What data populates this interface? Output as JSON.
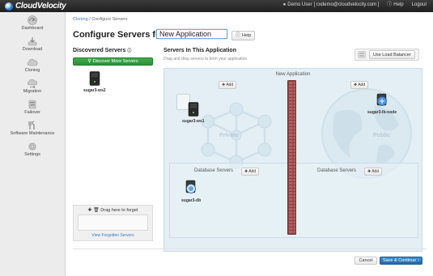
{
  "app": {
    "name": "CloudVelocity"
  },
  "topbar": {
    "user_label": "Demo User",
    "user_email": "[ cxdemo@cloudvelocity.com ]",
    "help_label": "Help",
    "logout_label": "Logout"
  },
  "sidebar": {
    "items": [
      {
        "label": "Dashboard",
        "icon": "dashboard-icon"
      },
      {
        "label": "Download",
        "icon": "download-icon"
      },
      {
        "label": "Cloning",
        "icon": "cloud-icon"
      },
      {
        "label": "Migration",
        "icon": "migration-icon"
      },
      {
        "label": "Failover",
        "icon": "failover-icon"
      },
      {
        "label": "Software Maintenance",
        "icon": "wrench-icon"
      },
      {
        "label": "Settings",
        "icon": "gear-icon"
      }
    ]
  },
  "breadcrumb": {
    "parent": "Cloning",
    "separator": "/",
    "current": "Configure Servers"
  },
  "page": {
    "title": "Configure Servers for",
    "app_name_value": "New Application",
    "help_label": "Help"
  },
  "discovered": {
    "title": "Discovered Servers",
    "discover_button": "Discover More Servers",
    "servers": [
      {
        "name": "sugar3-ws2"
      }
    ],
    "forget_label": "Drag here to forget",
    "forgotten_link": "View Forgotten Servers"
  },
  "application": {
    "title": "Servers In This Application",
    "subtitle": "Drag and drop servers to form your application",
    "load_balancer_button": "Use Load Balancer",
    "canvas_title": "New Application",
    "private_label": "Private",
    "public_label": "Public",
    "add_label": "Add",
    "private_servers": [
      {
        "name": "sugar3-ws1"
      }
    ],
    "public_servers": [
      {
        "name": "sugar3-lb-node"
      }
    ],
    "database_section_label": "Database Servers",
    "private_db_servers": [
      {
        "name": "sugar3-db"
      }
    ]
  },
  "footer": {
    "cancel_label": "Cancel",
    "save_label": "Save & Continue"
  },
  "colors": {
    "primary_green": "#2b8f37",
    "primary_blue": "#2668a5",
    "link_blue": "#3a7bbf",
    "firewall_red": "#b46060"
  }
}
